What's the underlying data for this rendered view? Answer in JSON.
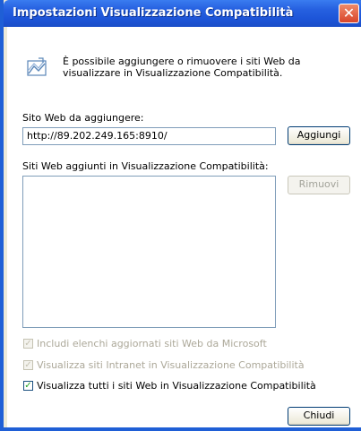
{
  "window": {
    "title": "Impostazioni Visualizzazione Compatibilità",
    "close_label": "✕"
  },
  "intro_text": "È possibile aggiungere o rimuovere i siti Web da visualizzare in Visualizzazione Compatibilità.",
  "add_site": {
    "label": "Sito Web da aggiungere:",
    "value": "http://89.202.249.165:8910/",
    "button_label": "Aggiungi"
  },
  "sites_list": {
    "label": "Siti Web aggiunti in Visualizzazione Compatibilità:",
    "items": [],
    "remove_button_label": "Rimuovi"
  },
  "options": [
    {
      "label": "Includi elenchi aggiornati siti Web da Microsoft",
      "checked": true,
      "enabled": false
    },
    {
      "label": "Visualizza siti Intranet in Visualizzazione Compatibilità",
      "checked": true,
      "enabled": false
    },
    {
      "label": "Visualizza tutti i siti Web in Visualizzazione Compatibilità",
      "checked": true,
      "enabled": true
    }
  ],
  "close_button_label": "Chiudi",
  "colors": {
    "titlebar": "#2660e0",
    "close_button": "#d8452a",
    "checkmark": "#21a121"
  }
}
